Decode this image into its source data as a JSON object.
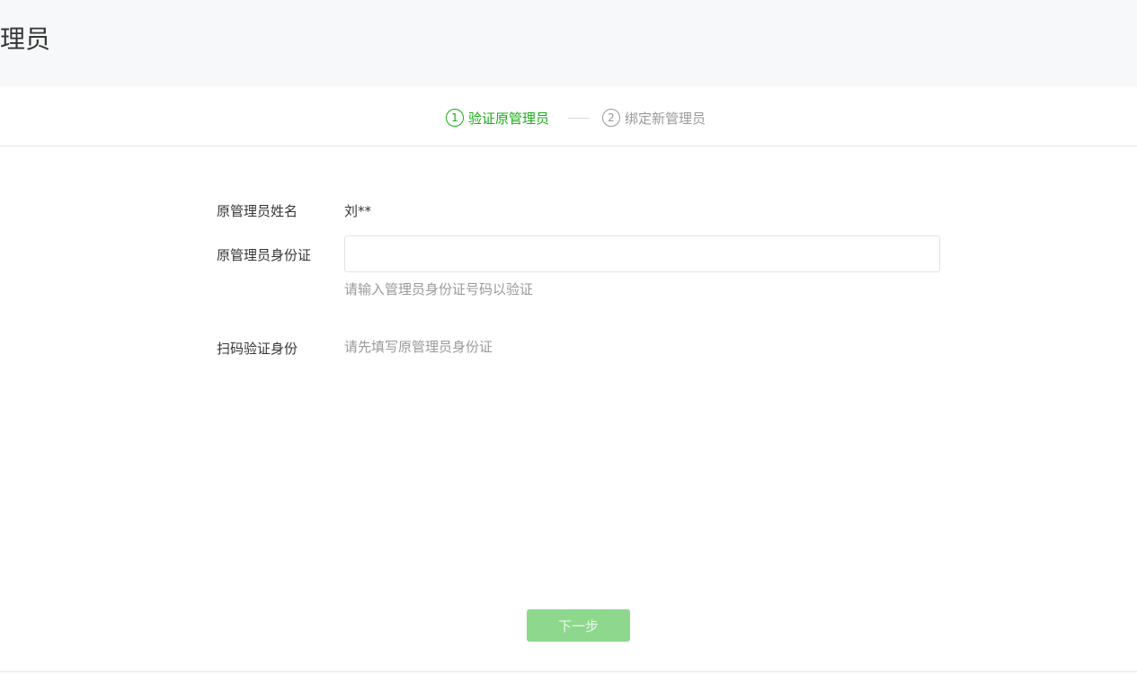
{
  "header": {
    "title": "管理员"
  },
  "steps": [
    {
      "number": "1",
      "label": "验证原管理员",
      "state": "active"
    },
    {
      "number": "2",
      "label": "绑定新管理员",
      "state": "inactive"
    }
  ],
  "form": {
    "name_label": "原管理员姓名",
    "name_value": "刘**",
    "id_label": "原管理员身份证",
    "id_input_value": "",
    "id_hint": "请输入管理员身份证号码以验证",
    "scan_label": "扫码验证身份",
    "scan_hint": "请先填写原管理员身份证"
  },
  "actions": {
    "next_label": "下一步"
  },
  "colors": {
    "accent": "#1aad19",
    "button_disabled": "#8ed88d",
    "header_bg": "#f6f8f9",
    "muted_text": "#9a9a9a"
  }
}
